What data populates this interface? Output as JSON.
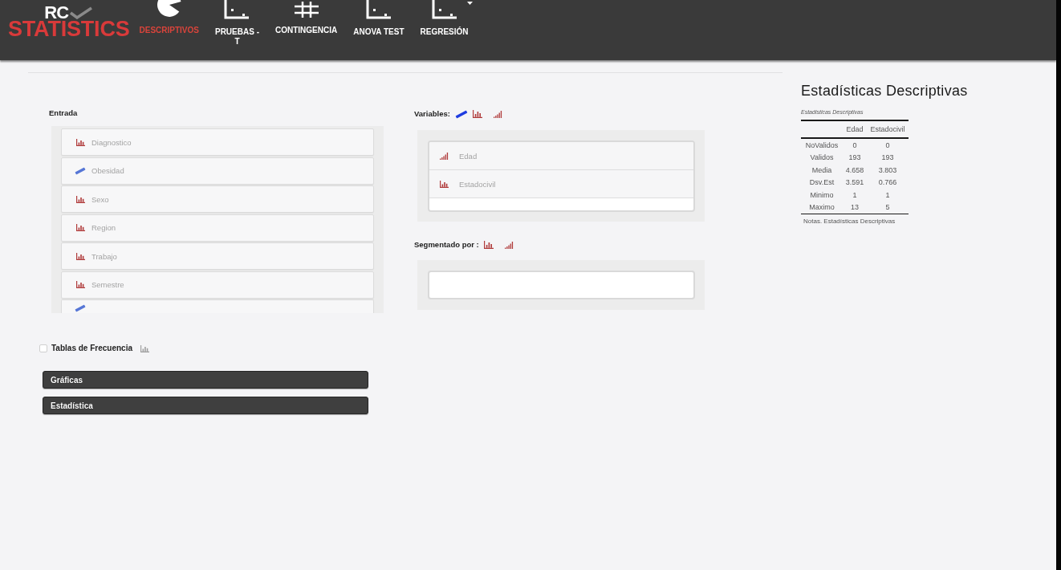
{
  "logo": {
    "initials": "RC",
    "wordmark": "STATISTICS"
  },
  "nav": {
    "items": [
      {
        "label": "DESCRIPTIVOS",
        "kind": "pie",
        "selected": true
      },
      {
        "label": "PRUEBAS -\nT",
        "kind": "scatter",
        "selected": false
      },
      {
        "label": "CONTINGENCIA",
        "kind": "grid",
        "selected": false
      },
      {
        "label": "ANOVA TEST",
        "kind": "scatter",
        "selected": false
      },
      {
        "label": "REGRESIÓN",
        "kind": "scatter",
        "selected": false
      }
    ]
  },
  "input": {
    "label": "Entrada",
    "items": [
      {
        "label": "Diagnostico",
        "kind": "nominal"
      },
      {
        "label": "Obesidad",
        "kind": "scale"
      },
      {
        "label": "Sexo",
        "kind": "nominal"
      },
      {
        "label": "Region",
        "kind": "nominal"
      },
      {
        "label": "Trabajo",
        "kind": "nominal"
      },
      {
        "label": "Semestre",
        "kind": "nominal"
      },
      {
        "kind": "scale"
      }
    ]
  },
  "variables": {
    "label": "Variables:",
    "items": [
      {
        "label": "Edad",
        "kind": "ordinal"
      },
      {
        "label": "Estadocivil",
        "kind": "nominal"
      }
    ]
  },
  "split": {
    "label": "Segmentado por :"
  },
  "frequency_tables": {
    "label": "Tablas de Frecuencia",
    "checked": false
  },
  "sections": [
    "Gráficas",
    "Estadística"
  ],
  "results": {
    "title": "Estadísticas Descriptivas",
    "caption": "Estadisticas Descriptivas",
    "columns": [
      "Edad",
      "Estadocivil"
    ],
    "rows": [
      {
        "label": "NoValidos",
        "values": [
          "0",
          "0"
        ]
      },
      {
        "label": "Validos",
        "values": [
          "193",
          "193"
        ]
      },
      {
        "label": "Media",
        "values": [
          "4.658",
          "3.803"
        ]
      },
      {
        "label": "Dsv.Est",
        "values": [
          "3.591",
          "0.766"
        ]
      },
      {
        "label": "Minimo",
        "values": [
          "1",
          "1"
        ]
      },
      {
        "label": "Maximo",
        "values": [
          "13",
          "5"
        ]
      }
    ],
    "note": "Notas. Estadísticas Descriptivas"
  }
}
